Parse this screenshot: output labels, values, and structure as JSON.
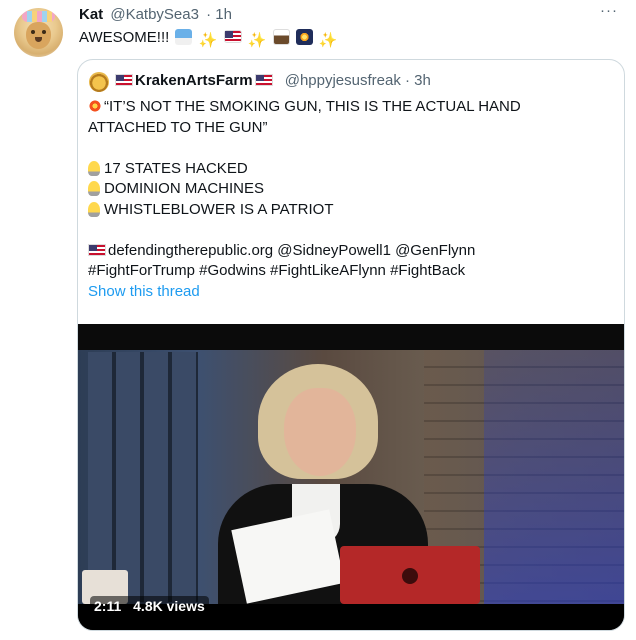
{
  "tweet": {
    "author_name": "Kat",
    "author_handle": "@KatbySea3",
    "time": "· 1h",
    "text": "AWESOME!!!",
    "more": "···"
  },
  "quoted": {
    "author_name": "KrakenArtsFarm",
    "author_handle": "@hppyjesusfreak",
    "time": "· 3h",
    "lines": {
      "l1": "“IT’S NOT THE SMOKING GUN, THIS IS THE ACTUAL HAND",
      "l2": "ATTACHED TO THE GUN”",
      "l3": "17 STATES HACKED",
      "l4": "DOMINION MACHINES",
      "l5": "WHISTLEBLOWER IS A PATRIOT",
      "l6": "defendingtherepublic.org @SidneyPowell1 @GenFlynn",
      "l7": "#FightForTrump #Godwins #FightLikeAFlynn #FightBack"
    },
    "show_thread": "Show this thread"
  },
  "video": {
    "duration": "2:11",
    "views": "4.8K views"
  },
  "colors": {
    "link": "#1d9bf0",
    "border": "#cfd9de",
    "secondary_text": "#536471"
  }
}
